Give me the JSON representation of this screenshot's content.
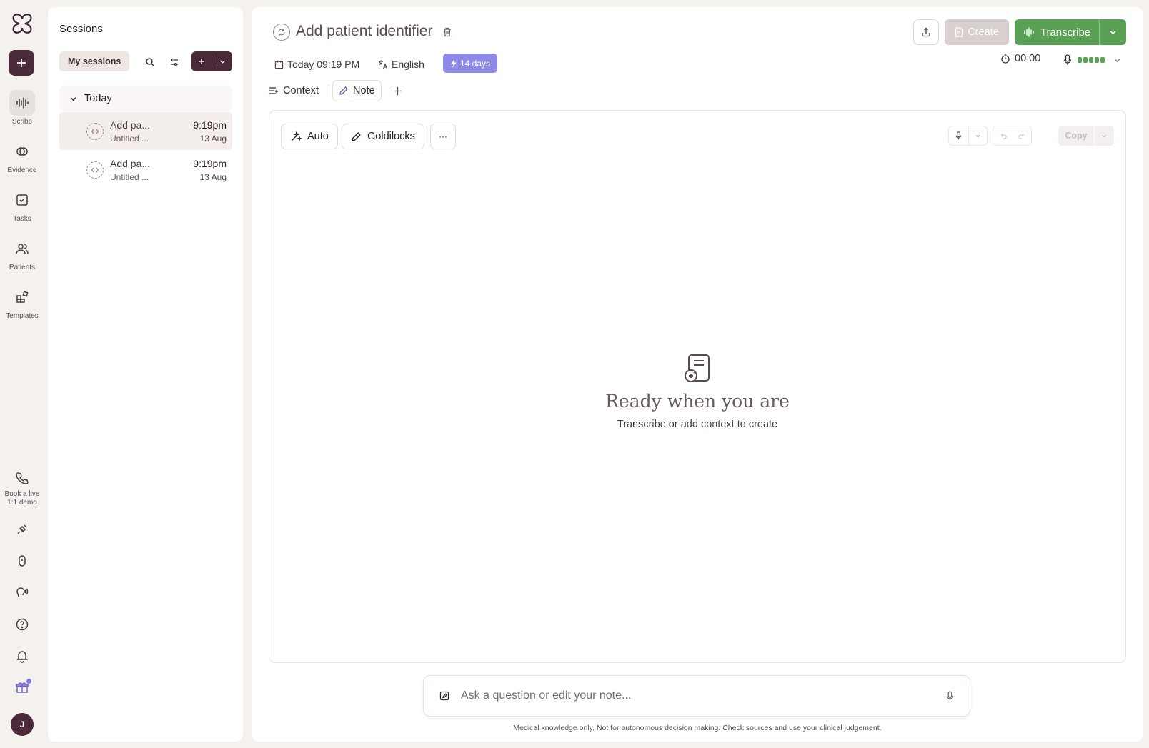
{
  "rail": {
    "items": [
      {
        "label": "Scribe",
        "icon": "waveform-icon"
      },
      {
        "label": "Evidence",
        "icon": "evidence-icon"
      },
      {
        "label": "Tasks",
        "icon": "tasks-icon"
      },
      {
        "label": "Patients",
        "icon": "patients-icon"
      },
      {
        "label": "Templates",
        "icon": "templates-icon"
      }
    ],
    "demo_label_1": "Book a live",
    "demo_label_2": "1:1 demo",
    "avatar_initial": "J"
  },
  "sessions": {
    "title": "Sessions",
    "filter_label": "My sessions",
    "group_label": "Today",
    "items": [
      {
        "name": "Add pa...",
        "sub": "Untitled ...",
        "time": "9:19pm",
        "date": "13 Aug"
      },
      {
        "name": "Add pa...",
        "sub": "Untitled ...",
        "time": "9:19pm",
        "date": "13 Aug"
      }
    ]
  },
  "header": {
    "title": "Add patient identifier",
    "date": "Today 09:19 PM",
    "language": "English",
    "days_badge": "14 days",
    "create_label": "Create",
    "transcribe_label": "Transcribe",
    "timer": "00:00"
  },
  "tabs": {
    "context": "Context",
    "note": "Note"
  },
  "editor": {
    "auto_label": "Auto",
    "template_label": "Goldilocks",
    "more_label": "···",
    "copy_label": "Copy",
    "empty_title": "Ready when you are",
    "empty_sub": "Transcribe or add context to create"
  },
  "ask": {
    "placeholder": "Ask a question or edit your note...",
    "disclaimer": "Medical knowledge only. Not for autonomous decision making. Check sources and use your clinical judgement."
  },
  "colors": {
    "accent_dark": "#4a2a38",
    "transcribe_green": "#5aa155",
    "badge_purple": "#8f8ae8"
  }
}
